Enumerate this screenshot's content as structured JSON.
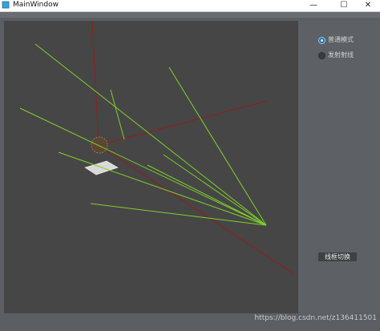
{
  "window": {
    "title": "MainWindow",
    "minimize_glyph": "—",
    "maximize_glyph": "☐",
    "close_glyph": "✕"
  },
  "side_panel": {
    "mode_options": [
      {
        "label": "普通模式",
        "checked": true
      },
      {
        "label": "发射射线",
        "checked": false
      }
    ],
    "switch_button_label": "线框切换"
  },
  "watermark": "https://blog.csdn.net/z136411501",
  "colors": {
    "viewport_bg": "#464646",
    "ray_color": "#7fd12a",
    "axis_color": "#8a2222",
    "panel_bg": "#5d6165"
  }
}
